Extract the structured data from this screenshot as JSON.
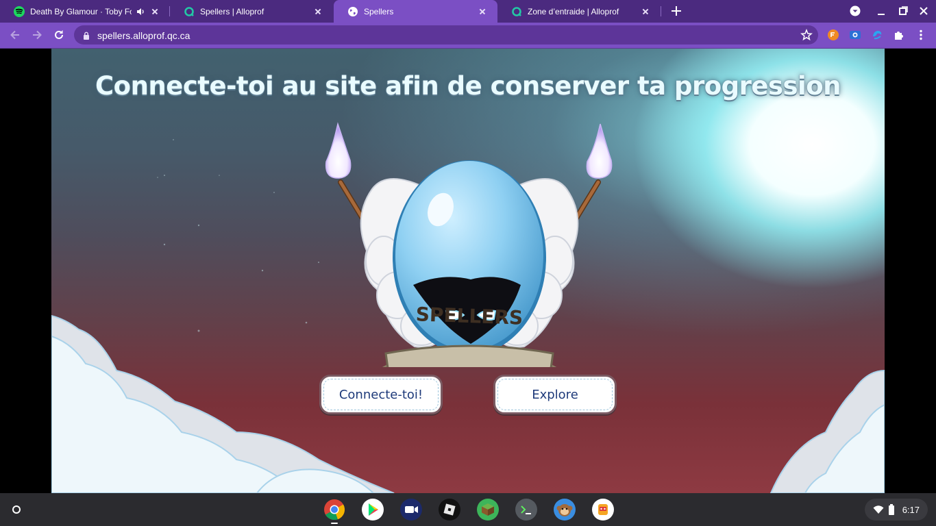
{
  "browser": {
    "tabs": [
      {
        "title": "Death By Glamour · Toby Fox",
        "favicon": "spotify-icon",
        "audio": true,
        "active": false
      },
      {
        "title": "Spellers | Alloprof",
        "favicon": "alloprof-icon",
        "audio": false,
        "active": false
      },
      {
        "title": "Spellers",
        "favicon": "globe-icon",
        "audio": false,
        "active": true
      },
      {
        "title": "Zone d’entraide | Alloprof",
        "favicon": "alloprof-icon",
        "audio": false,
        "active": false
      }
    ],
    "url": "spellers.alloprof.qc.ca",
    "colors": {
      "frame": "#4b2a7f",
      "toolbar": "#7b4fc4"
    }
  },
  "page": {
    "headline": "Connecte-toi au site afin de conserver ta progression",
    "logo_text": "SPELLERS",
    "buttons": {
      "login": "Connecte-toi!",
      "explore": "Explore"
    }
  },
  "shelf": {
    "apps": [
      "chrome-icon",
      "play-store-icon",
      "zoom-icon",
      "roblox-icon",
      "minecraft-icon",
      "terminal-icon",
      "monkey-app-icon",
      "face-app-icon"
    ],
    "time": "6:17"
  }
}
